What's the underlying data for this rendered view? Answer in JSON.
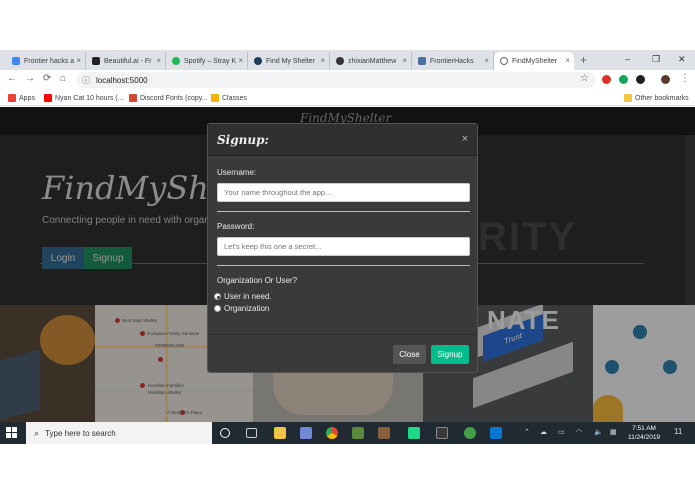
{
  "browser": {
    "tabs": [
      {
        "title": "Frontier hacks a",
        "fav": "#4285f4",
        "active": false
      },
      {
        "title": "Beautiful.ai - Fr",
        "fav": "#222222",
        "active": false
      },
      {
        "title": "Spotify – Stray K",
        "fav": "#1db954",
        "active": false
      },
      {
        "title": "Find My Shelter",
        "fav": "#1e3a5f",
        "active": false
      },
      {
        "title": "zhixianMatthew",
        "fav": "#333333",
        "active": false
      },
      {
        "title": "FrontierHacks",
        "fav": "#4a6fa5",
        "active": false
      },
      {
        "title": "FindMyShelter",
        "fav": "#5f6368",
        "active": true
      }
    ],
    "tab_close": "×",
    "new_tab": "+",
    "window_controls": {
      "minimize": "–",
      "maximize": "❐",
      "close": "✕"
    },
    "nav": {
      "back": "←",
      "forward": "→",
      "reload": "⟳",
      "home": "⌂"
    },
    "url": "localhost:5000",
    "star": "☆",
    "extensions": [
      {
        "name": "adblock-icon",
        "color": "#d93025",
        "label": "ABP"
      },
      {
        "name": "extension-green-icon",
        "color": "#1aa260",
        "label": ""
      },
      {
        "name": "extension-dark-icon",
        "color": "#202124",
        "label": ""
      },
      {
        "name": "profile-avatar-icon",
        "color": "#5a3a2a",
        "label": ""
      }
    ],
    "menu": "⋮",
    "bookmarks": [
      {
        "label": "Apps",
        "color": "#ea4335"
      },
      {
        "label": "Nyan Cat 10 hours (...",
        "color": "#ff0000"
      },
      {
        "label": "Discord Fonts (copy...",
        "color": "#d14836"
      },
      {
        "label": "Classes",
        "color": "#f4b400"
      }
    ],
    "other_bookmarks": "Other bookmarks"
  },
  "page": {
    "navbar_brand": "FindMyShelter",
    "hero_title": "FindMyShelt",
    "hero_subtitle": "Connecting people in need with organ",
    "hero_bg_word": "RITY",
    "login_label": "Login",
    "signup_label": "Signup",
    "donate_word": "NATE",
    "map_labels": [
      "Next Step Shelter",
      "Compass Family Services",
      "TENDERLOIN",
      "Hamilton Families",
      "Hamilton Shelter",
      "A Woman's Place"
    ],
    "trust_label": "Trust"
  },
  "modal": {
    "title": "Signup:",
    "close_x": "×",
    "username_label": "Username:",
    "username_placeholder": "Your name throughout the app...",
    "password_label": "Password:",
    "password_placeholder": "Let's keep this one a secret...",
    "org_label": "Organization Or User?",
    "options": [
      {
        "label": "User in need.",
        "checked": true
      },
      {
        "label": "Organization",
        "checked": false
      }
    ],
    "close_button": "Close",
    "signup_button": "Signup"
  },
  "taskbar": {
    "search_placeholder": "Type here to search",
    "time": "7:51 AM",
    "date": "11/24/2019",
    "notifications": "11"
  }
}
